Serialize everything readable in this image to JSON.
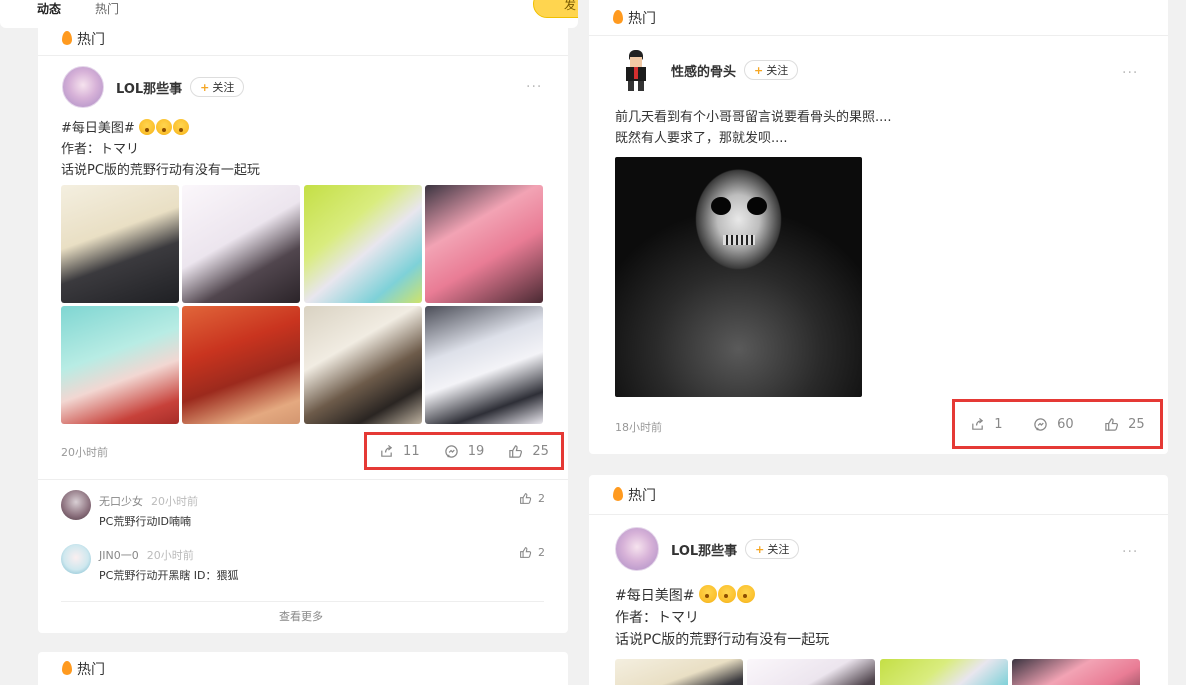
{
  "nav": {
    "tabs": [
      "动态",
      "热门"
    ],
    "button_label": "发"
  },
  "left": {
    "post": {
      "section_label": "热门",
      "user": "LOL那些事",
      "follow_label": "关注",
      "more_label": "···",
      "text_lines": [
        "#每日美图# ",
        "作者：トマリ",
        "话说PC版的荒野行动有没有一起玩"
      ],
      "time": "20小时前",
      "shares": "11",
      "comments": "19",
      "likes": "25"
    },
    "comments": [
      {
        "name": "无口少女",
        "time": "20小时前",
        "text": "PC荒野行动ID喃喃",
        "likes": "2"
      },
      {
        "name": "JIN0一0",
        "time": "20小时前",
        "text": "PC荒野行动开黑瞎 ID：猥狐",
        "likes": "2"
      }
    ],
    "see_more": "查看更多",
    "next_section_label": "热门"
  },
  "right": {
    "post1": {
      "section_label": "热门",
      "user": "性感的骨头",
      "follow_label": "关注",
      "more_label": "···",
      "text_lines": [
        "前几天看到有个小哥哥留言说要看骨头的果照....",
        "既然有人要求了，那就发呗...."
      ],
      "time": "18小时前",
      "shares": "1",
      "comments": "60",
      "likes": "25"
    },
    "post2": {
      "section_label": "热门",
      "user": "LOL那些事",
      "follow_label": "关注",
      "more_label": "···",
      "text_lines": [
        "#每日美图# ",
        "作者：トマリ",
        "话说PC版的荒野行动有没有一起玩"
      ]
    }
  },
  "colors": {
    "accent": "#ff9a1f",
    "highlight_box": "#e53935",
    "follow_plus": "#f5a623"
  }
}
